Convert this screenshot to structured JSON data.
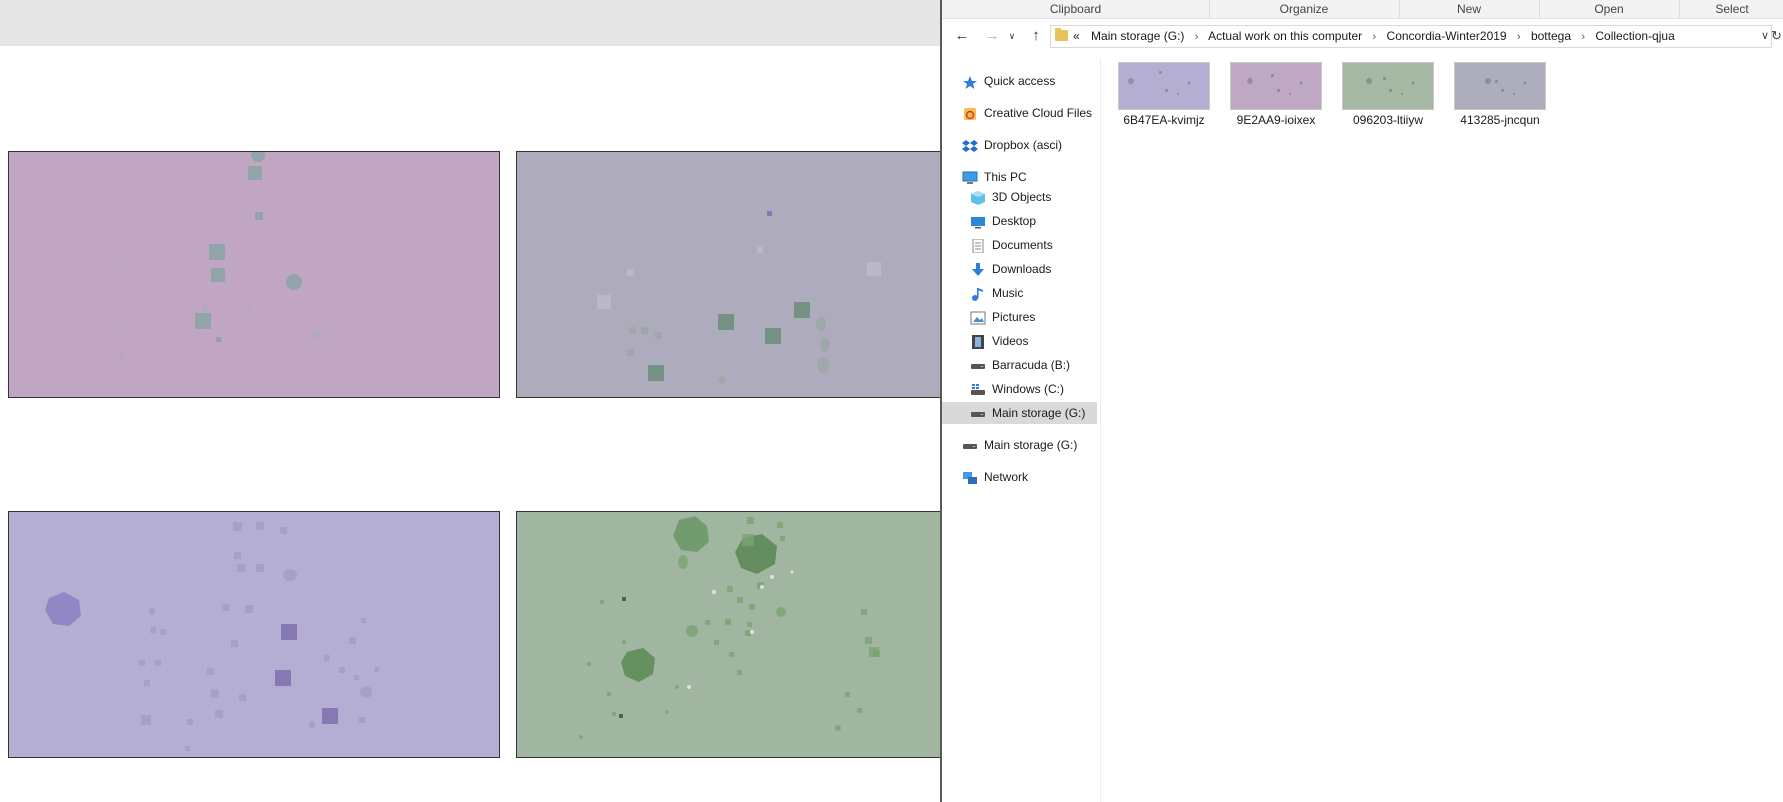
{
  "ribbon": {
    "groups": [
      "Clipboard",
      "Organize",
      "New",
      "Open",
      "Select"
    ]
  },
  "address": {
    "overflow": "«",
    "crumbs": [
      "Main storage (G:)",
      "Actual work on this computer",
      "Concordia-Winter2019",
      "bottega",
      "Collection-qjua"
    ]
  },
  "nav": {
    "items": [
      {
        "label": "Quick access",
        "icon": "star-icon"
      },
      {
        "label": "Creative Cloud Files",
        "icon": "creative-cloud-icon"
      },
      {
        "label": "Dropbox (asci)",
        "icon": "dropbox-icon"
      },
      {
        "label": "This PC",
        "icon": "computer-icon"
      },
      {
        "label": "3D Objects",
        "icon": "cube-icon"
      },
      {
        "label": "Desktop",
        "icon": "desktop-icon"
      },
      {
        "label": "Documents",
        "icon": "document-icon"
      },
      {
        "label": "Downloads",
        "icon": "download-arrow-icon"
      },
      {
        "label": "Music",
        "icon": "music-note-icon"
      },
      {
        "label": "Pictures",
        "icon": "picture-icon"
      },
      {
        "label": "Videos",
        "icon": "film-icon"
      },
      {
        "label": "Barracuda (B:)",
        "icon": "drive-icon"
      },
      {
        "label": "Windows (C:)",
        "icon": "windows-drive-icon"
      },
      {
        "label": "Main storage (G:)",
        "icon": "drive-icon"
      },
      {
        "label": "Main storage (G:)",
        "icon": "drive-icon"
      },
      {
        "label": "Network",
        "icon": "network-icon"
      }
    ],
    "selected": 13
  },
  "files": [
    {
      "name": "6B47EA-kvimjz",
      "color": "#b3aed2"
    },
    {
      "name": "9E2AA9-ioixex",
      "color": "#bfa8c4"
    },
    {
      "name": "096203-ltiiyw",
      "color": "#a4b8a3"
    },
    {
      "name": "413285-jncqun",
      "color": "#aeadbd"
    }
  ],
  "panels": {
    "colors": {
      "pink": "#c0a6c2",
      "grey": "#adabbc",
      "lavender": "#b3aed2",
      "green": "#a1b6a0"
    }
  }
}
